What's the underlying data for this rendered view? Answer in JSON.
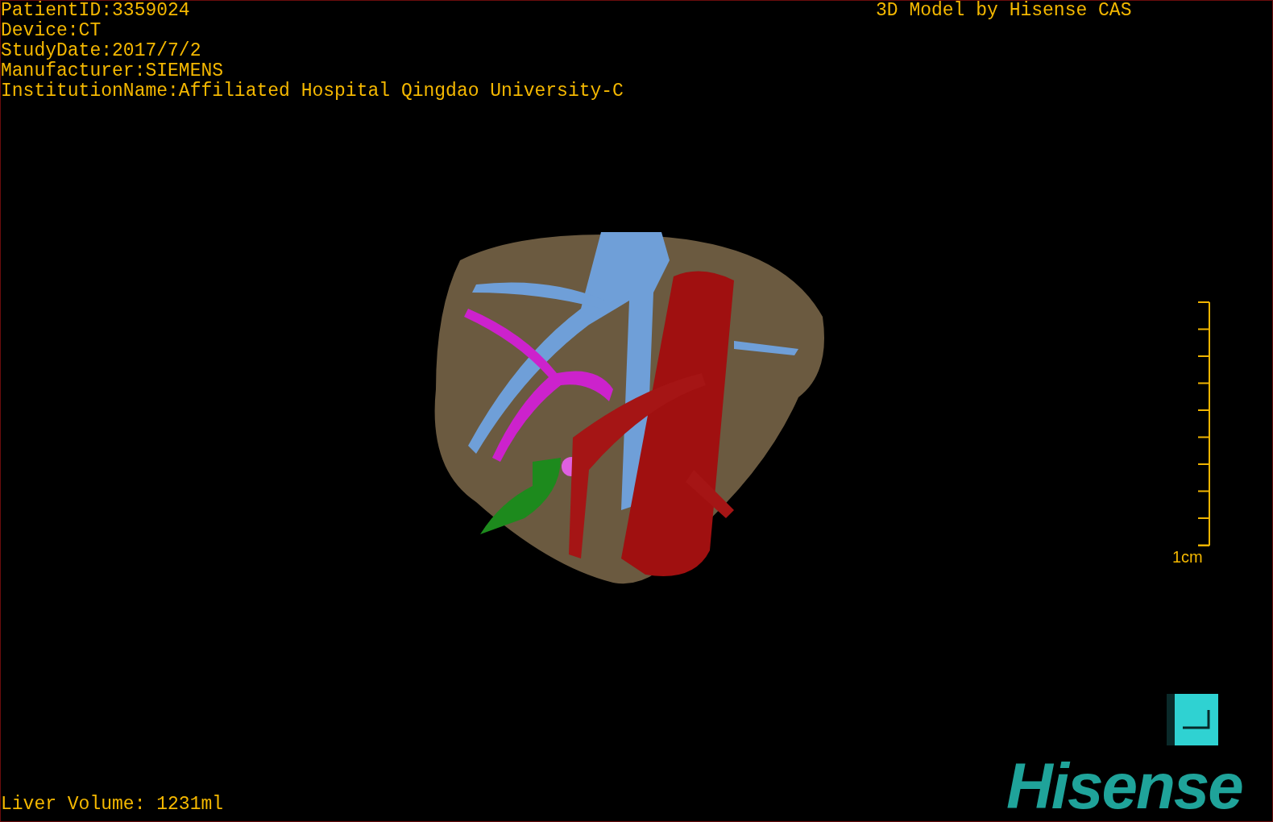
{
  "header_lines": [
    "PatientID:3359024",
    "Device:CT",
    "StudyDate:2017/7/2",
    "Manufacturer:SIEMENS",
    "InstitutionName:Affiliated Hospital Qingdao University-C"
  ],
  "title": "3D Model by Hisense CAS",
  "scale": {
    "label": "1cm"
  },
  "volume": "Liver Volume: 1231ml",
  "logo": "Hisense"
}
